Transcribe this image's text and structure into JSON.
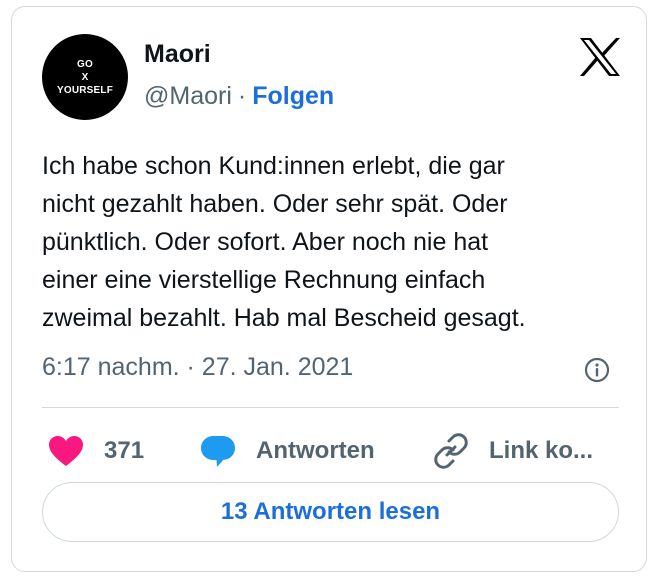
{
  "author": {
    "avatar_lines": [
      "GO",
      "X",
      "YOURSELF"
    ],
    "name": "Maori",
    "handle": "@Maori",
    "separator": "·",
    "follow_label": "Folgen"
  },
  "tweet": {
    "text": "Ich habe schon Kund:innen erlebt, die gar\nnicht gezahlt haben. Oder sehr spät. Oder\npünktlich. Oder sofort. Aber noch nie hat\neiner eine vierstellige Rechnung einfach\nzweimal bezahlt. Hab mal Bescheid gesagt.",
    "timestamp": "6:17 nachm. · 27. Jan. 2021"
  },
  "actions": {
    "likes": "371",
    "reply_label": "Antworten",
    "copy_link_label": "Link ko..."
  },
  "read_replies_label": "13 Antworten lesen",
  "colors": {
    "accent": "#1d6fd8",
    "like": "#f91880",
    "reply_bubble": "#1d9bf0",
    "muted": "#536471",
    "border": "#cfd9de"
  },
  "icons": [
    "x-logo-icon",
    "info-icon",
    "heart-icon",
    "speech-bubble-icon",
    "link-icon"
  ]
}
